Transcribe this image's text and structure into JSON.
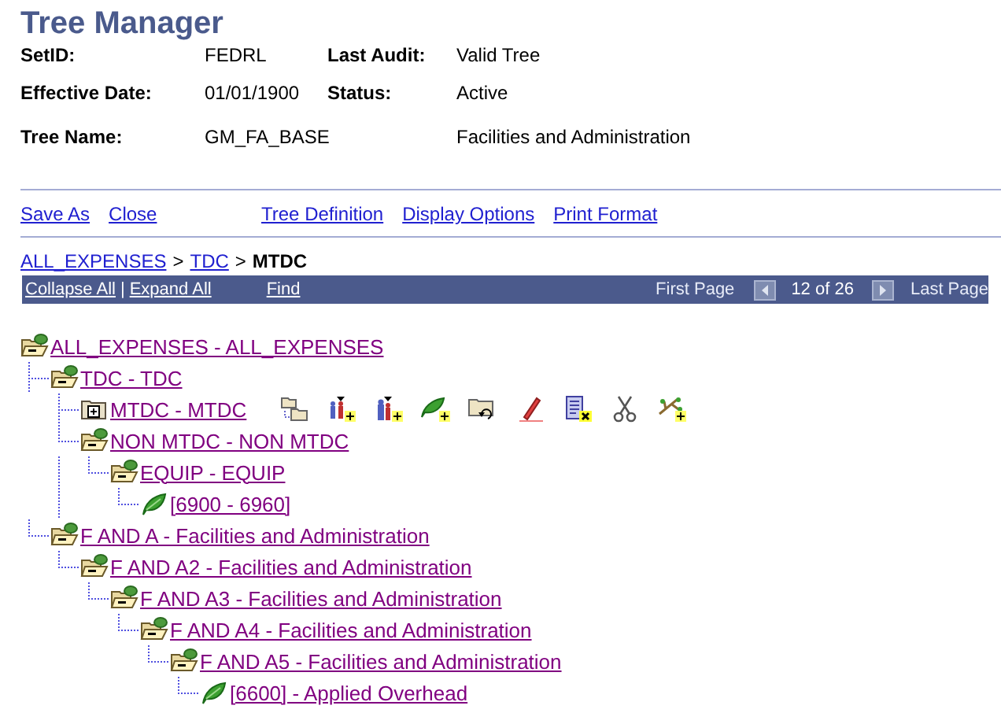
{
  "page_title": "Tree Manager",
  "fields": [
    {
      "label": "SetID:",
      "value": "FEDRL",
      "label2": "Last Audit:",
      "value2": "Valid Tree"
    },
    {
      "label": "Effective Date:",
      "value": "01/01/1900",
      "label2": "Status:",
      "value2": "Active"
    },
    {
      "label": "Tree Name:",
      "value": "GM_FA_BASE",
      "value2": "Facilities and Administration"
    }
  ],
  "actions_left": [
    "Save As",
    "Close"
  ],
  "actions_right": [
    "Tree Definition",
    "Display Options",
    "Print Format"
  ],
  "breadcrumb": {
    "links": [
      "ALL_EXPENSES",
      "TDC"
    ],
    "separator": ">",
    "current": "MTDC"
  },
  "toolbar": {
    "collapse": "Collapse All",
    "separator": "|",
    "expand": "Expand All",
    "find": "Find",
    "first": "First Page",
    "position": "12 of 26",
    "last": "Last Page"
  },
  "tree": [
    {
      "label": "ALL_EXPENSES - ALL_EXPENSES",
      "kind": "folder",
      "expanded": true,
      "selected": false,
      "children": [
        {
          "label": "TDC - TDC",
          "kind": "folder",
          "expanded": true,
          "selected": false,
          "children": [
            {
              "label": "MTDC - MTDC",
              "kind": "folder",
              "expanded": false,
              "selected": true
            },
            {
              "label": "NON MTDC - NON MTDC",
              "kind": "folder",
              "expanded": true,
              "selected": false,
              "children": [
                {
                  "label": "EQUIP - EQUIP",
                  "kind": "folder",
                  "expanded": true,
                  "selected": false,
                  "children": [
                    {
                      "label": "[6900 - 6960]",
                      "kind": "leaf",
                      "selected": false
                    }
                  ]
                }
              ]
            }
          ]
        },
        {
          "label": "F AND A - Facilities and Administration",
          "kind": "folder",
          "expanded": true,
          "selected": false,
          "children": [
            {
              "label": "F AND A2 - Facilities and Administration",
              "kind": "folder",
              "expanded": true,
              "selected": false,
              "children": [
                {
                  "label": "F AND A3 - Facilities and Administration",
                  "kind": "folder",
                  "expanded": true,
                  "selected": false,
                  "children": [
                    {
                      "label": "F AND A4 - Facilities and Administration",
                      "kind": "folder",
                      "expanded": true,
                      "selected": false,
                      "children": [
                        {
                          "label": "F AND A5 - Facilities and Administration",
                          "kind": "folder",
                          "expanded": true,
                          "selected": false,
                          "children": [
                            {
                              "label": "[6600] - Applied Overhead",
                              "kind": "leaf",
                              "selected": false
                            }
                          ]
                        }
                      ]
                    }
                  ]
                }
              ]
            }
          ]
        }
      ]
    }
  ]
}
